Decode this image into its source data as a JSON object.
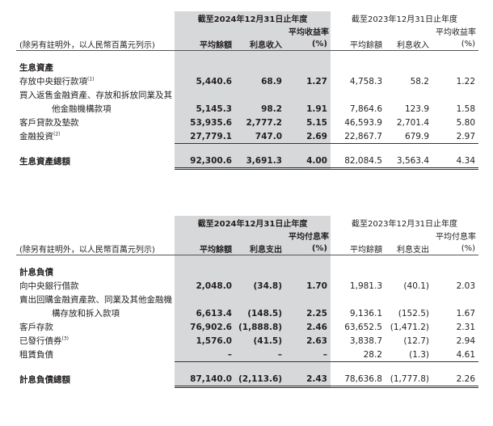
{
  "table1": {
    "period_current": "截至2024年12月31日止年度",
    "period_prior": "截至2023年12月31日止年度",
    "yield_header": "平均收益率",
    "unit_note": "(除另有註明外，以人民幣百萬元列示)",
    "col_avg_balance": "平均餘額",
    "col_interest": "利息收入",
    "col_percent": "(%)",
    "section_title": "生息資產",
    "rows": [
      {
        "label": "存放中央銀行款項",
        "sup": "(1)",
        "c1": "5,440.6",
        "c2": "68.9",
        "c3": "1.27",
        "p1": "4,758.3",
        "p2": "58.2",
        "p3": "1.22"
      },
      {
        "label": "買入返售金融資產、存放和拆放同業及其",
        "c1": "",
        "c2": "",
        "c3": "",
        "p1": "",
        "p2": "",
        "p3": ""
      },
      {
        "label": "他金融機構款項",
        "c1": "5,145.3",
        "c2": "98.2",
        "c3": "1.91",
        "p1": "7,864.6",
        "p2": "123.9",
        "p3": "1.58"
      },
      {
        "label": "客戶貸款及墊款",
        "c1": "53,935.6",
        "c2": "2,777.2",
        "c3": "5.15",
        "p1": "46,593.9",
        "p2": "2,701.4",
        "p3": "5.80"
      },
      {
        "label": "金融投資",
        "sup": "(2)",
        "c1": "27,779.1",
        "c2": "747.0",
        "c3": "2.69",
        "p1": "22,867.7",
        "p2": "679.9",
        "p3": "2.97"
      }
    ],
    "total": {
      "label": "生息資產總額",
      "c1": "92,300.6",
      "c2": "3,691.3",
      "c3": "4.00",
      "p1": "82,084.5",
      "p2": "3,563.4",
      "p3": "4.34"
    }
  },
  "table2": {
    "period_current": "截至2024年12月31日止年度",
    "period_prior": "截至2023年12月31日止年度",
    "yield_header": "平均付息率",
    "unit_note": "(除另有註明外，以人民幣百萬元列示)",
    "col_avg_balance": "平均餘額",
    "col_interest": "利息支出",
    "col_percent": "(%)",
    "section_title": "計息負債",
    "rows": [
      {
        "label": "向中央銀行借款",
        "c1": "2,048.0",
        "c2": "(34.8)",
        "c3": "1.70",
        "p1": "1,981.3",
        "p2": "(40.1)",
        "p3": "2.03"
      },
      {
        "label": "賣出回購金融資產款、同業及其他金融機",
        "c1": "",
        "c2": "",
        "c3": "",
        "p1": "",
        "p2": "",
        "p3": ""
      },
      {
        "label": "構存放和拆入款項",
        "c1": "6,613.4",
        "c2": "(148.5)",
        "c3": "2.25",
        "p1": "9,136.1",
        "p2": "(152.5)",
        "p3": "1.67"
      },
      {
        "label": "客戶存款",
        "c1": "76,902.6",
        "c2": "(1,888.8)",
        "c3": "2.46",
        "p1": "63,652.5",
        "p2": "(1,471.2)",
        "p3": "2.31"
      },
      {
        "label": "已發行債券",
        "sup": "(3)",
        "c1": "1,576.0",
        "c2": "(41.5)",
        "c3": "2.63",
        "p1": "3,838.7",
        "p2": "(12.7)",
        "p3": "2.94"
      },
      {
        "label": "租賃負債",
        "c1": "–",
        "c2": "–",
        "c3": "–",
        "p1": "28.2",
        "p2": "(1.3)",
        "p3": "4.61"
      }
    ],
    "total": {
      "label": "計息負債總額",
      "c1": "87,140.0",
      "c2": "(2,113.6)",
      "c3": "2.43",
      "p1": "78,636.8",
      "p2": "(1,777.8)",
      "p3": "2.26"
    }
  }
}
